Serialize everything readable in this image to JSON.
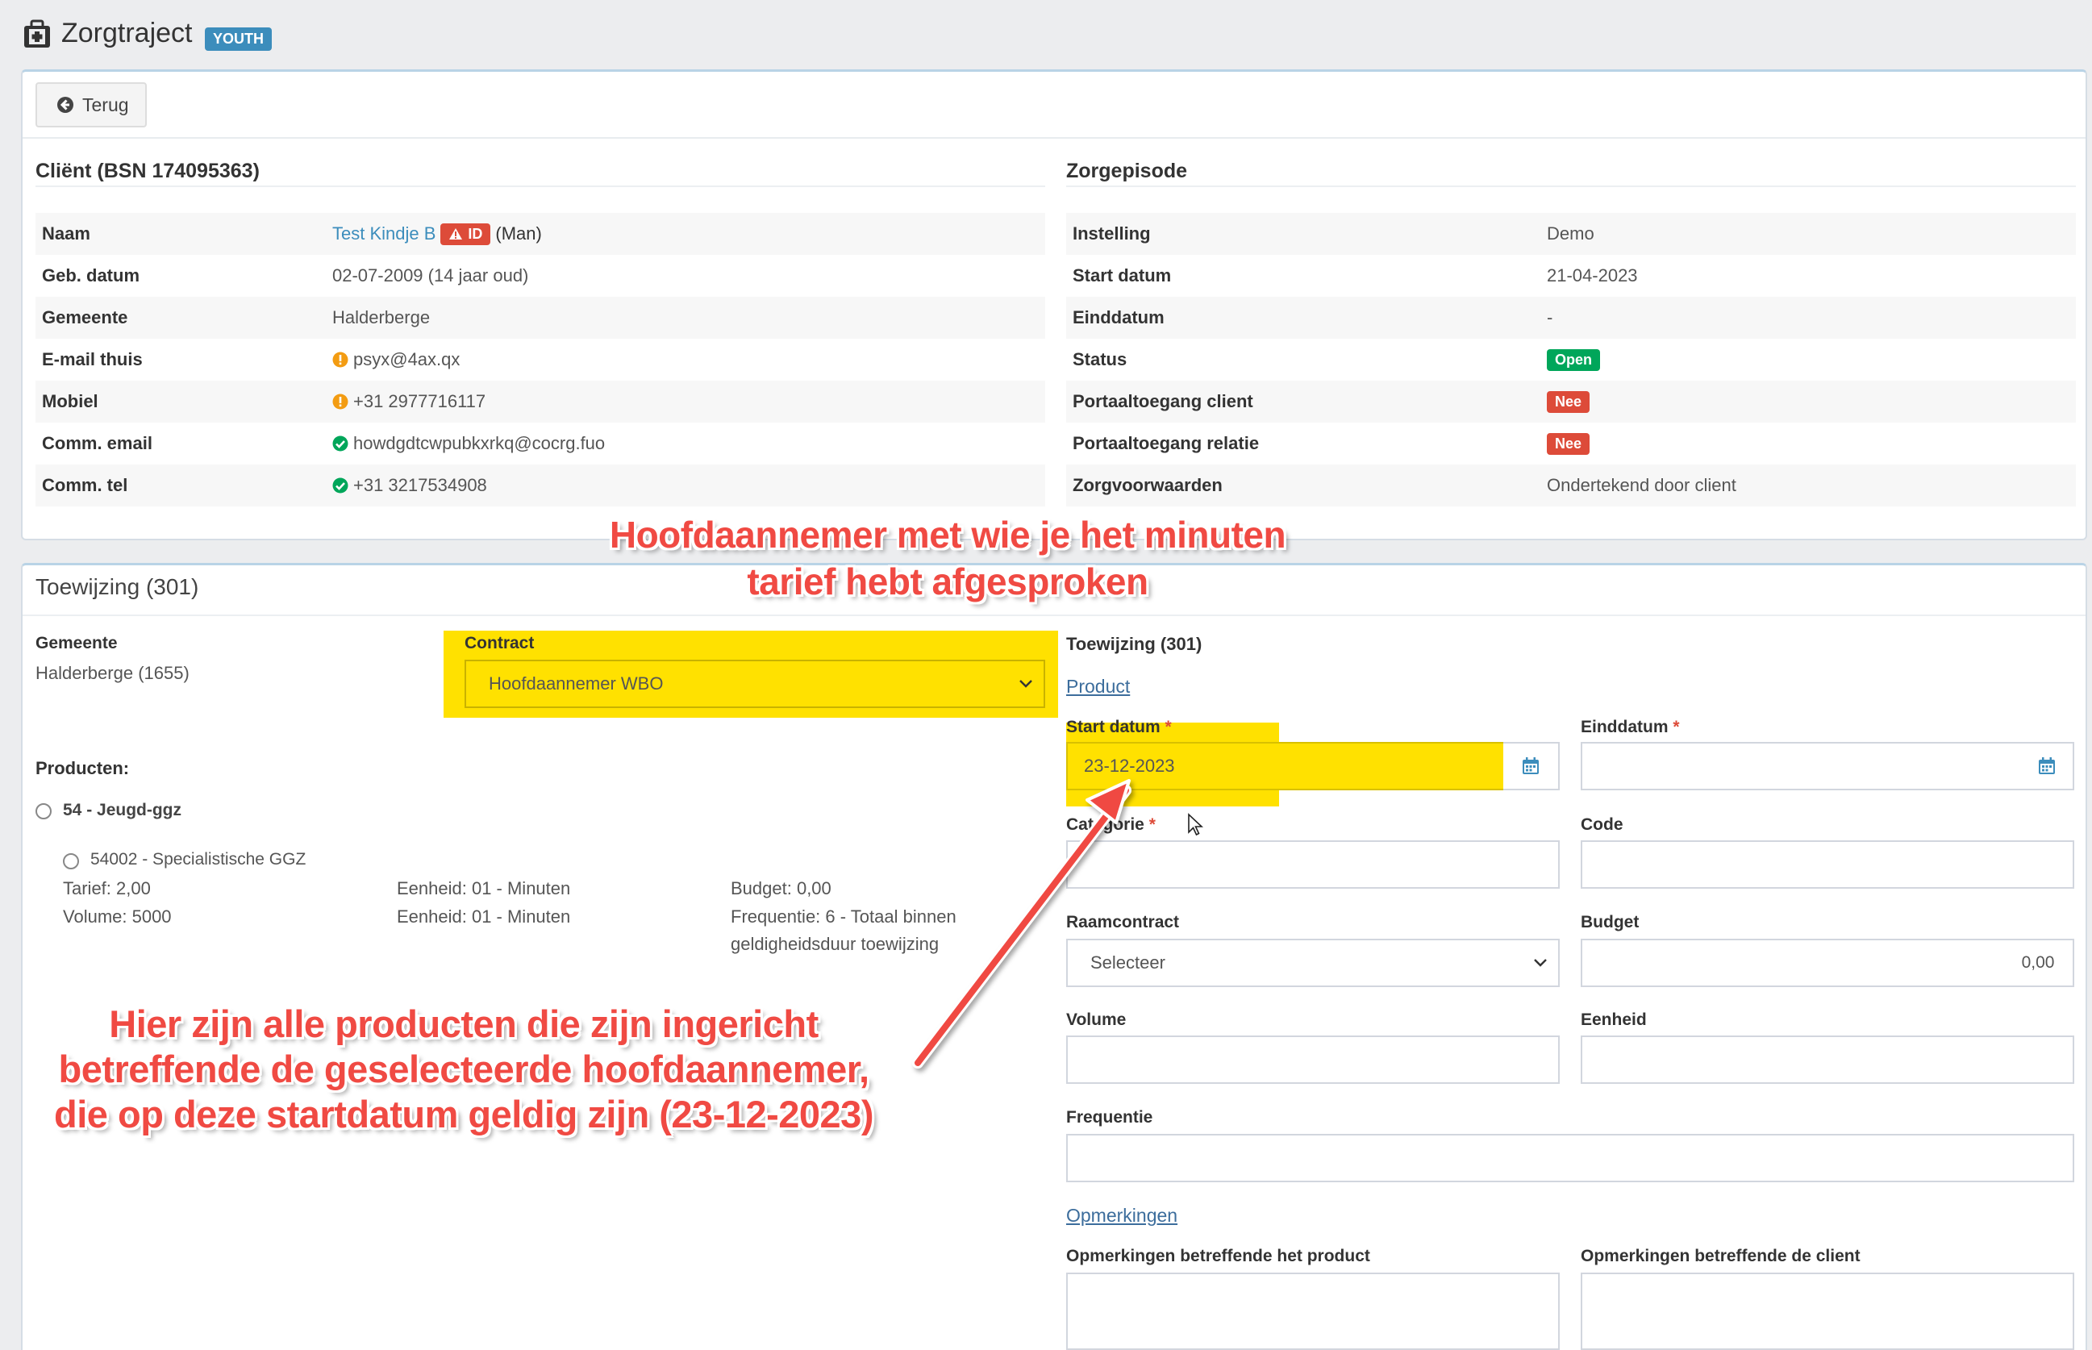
{
  "header": {
    "title": "Zorgtraject",
    "badge": "YOUTH",
    "icon": "medkit-icon"
  },
  "toolbar": {
    "back_label": "Terug"
  },
  "client": {
    "title": "Cliënt (BSN 174095363)",
    "rows": [
      {
        "label": "Naam",
        "name": "Test Kindje B",
        "id_badge": "ID",
        "suffix": "(Man)"
      },
      {
        "label": "Geb. datum",
        "value": "02-07-2009 (14 jaar oud)"
      },
      {
        "label": "Gemeente",
        "value": "Halderberge"
      },
      {
        "label": "E-mail thuis",
        "value": "psyx@4ax.qx"
      },
      {
        "label": "Mobiel",
        "value": "+31 2977716117"
      },
      {
        "label": "Comm. email",
        "value": "howdgdtcwpubkxrkq@cocrg.fuo"
      },
      {
        "label": "Comm. tel",
        "value": "+31 3217534908"
      }
    ]
  },
  "episode": {
    "title": "Zorgepisode",
    "rows": [
      {
        "label": "Instelling",
        "value": "Demo"
      },
      {
        "label": "Start datum",
        "value": "21-04-2023"
      },
      {
        "label": "Einddatum",
        "value": "-"
      },
      {
        "label": "Status",
        "value": "Open"
      },
      {
        "label": "Portaaltoegang client",
        "value": "Nee"
      },
      {
        "label": "Portaaltoegang relatie",
        "value": "Nee"
      },
      {
        "label": "Zorgvoorwaarden",
        "value": "Ondertekend door client"
      }
    ]
  },
  "toewijzing": {
    "panel_title": "Toewijzing (301)",
    "gemeente_label": "Gemeente",
    "gemeente_value": "Halderberge (1655)",
    "contract_label": "Contract",
    "contract_value": "Hoofdaannemer WBO",
    "producten_label": "Producten:",
    "product_group": "54 - Jeugd-ggz",
    "product_item": "54002 - Specialistische GGZ",
    "tarief": "Tarief: 2,00",
    "volume": "Volume: 5000",
    "eenheid1": "Eenheid: 01 - Minuten",
    "eenheid2": "Eenheid: 01 - Minuten",
    "budget": "Budget: 0,00",
    "frequentie_line1": "Frequentie: 6 - Totaal binnen",
    "frequentie_line2": "geldigheidsduur toewijzing"
  },
  "form": {
    "title": "Toewijzing (301)",
    "product_link": "Product",
    "start_label": "Start datum",
    "start_value": "23-12-2023",
    "eind_label": "Einddatum",
    "categorie_label": "Categorie",
    "code_label": "Code",
    "raamcontract_label": "Raamcontract",
    "raamcontract_value": "Selecteer",
    "budget_label": "Budget",
    "budget_addon": "0,00",
    "volume_label": "Volume",
    "eenheid_label": "Eenheid",
    "frequentie_label": "Frequentie",
    "opmerkingen_link": "Opmerkingen",
    "opm_product_label": "Opmerkingen betreffende het product",
    "opm_client_label": "Opmerkingen betreffende de client",
    "required_mark": "*"
  },
  "annotations": {
    "top_line1": "Hoofdaannemer met wie je het minuten",
    "top_line2": "tarief hebt afgesproken",
    "bottom_line1": "Hier zijn alle producten die zijn ingericht",
    "bottom_line2": "betreffende de geselecteerde hoofdaannemer,",
    "bottom_line3": "die op deze startdatum geldig zijn (23-12-2023)"
  },
  "colors": {
    "primary": "#3c8dbc",
    "danger": "#dd4b39",
    "success": "#00a65a",
    "highlight": "#ffe100",
    "annotation": "#f04a43"
  }
}
